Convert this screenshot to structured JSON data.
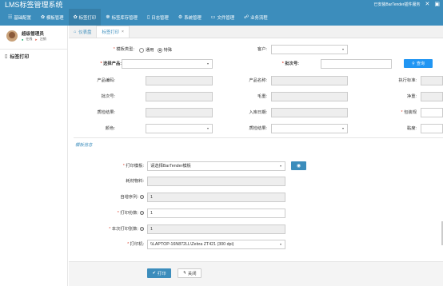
{
  "app": {
    "title": "LMS标签管理系统",
    "install_link": "已安装BarTender插件服务"
  },
  "nav": [
    {
      "icon": "☷",
      "label": "基础配置"
    },
    {
      "icon": "✿",
      "label": "模板管理"
    },
    {
      "icon": "✿",
      "label": "标签打印"
    },
    {
      "icon": "☸",
      "label": "标签库存管理"
    },
    {
      "icon": "▯",
      "label": "日志管理"
    },
    {
      "icon": "⚙",
      "label": "系统管理"
    },
    {
      "icon": "▭",
      "label": "文件管理"
    },
    {
      "icon": "☍",
      "label": "业务流程"
    }
  ],
  "user": {
    "name": "超级管理员",
    "online": "在线",
    "logout": "注销"
  },
  "sidebar": {
    "items": [
      {
        "icon": "▯",
        "label": "标签打印"
      }
    ]
  },
  "tabs": [
    {
      "icon": "⌂",
      "label": "仪表盘"
    },
    {
      "label": "标签打印",
      "close": "×"
    }
  ],
  "form": {
    "template_type_label": "模板类型:",
    "template_type_options": [
      "通用",
      "特殊"
    ],
    "customer_label": "客户:",
    "select_product_label": "选择产品:",
    "batch_label": "批次号:",
    "query_button": "查询",
    "product_code_label": "产品编码:",
    "product_name_label": "产品名称:",
    "exec_standard_label": "执行标准:",
    "batch2_label": "批次号:",
    "gross_weight_label": "毛重:",
    "net_weight_label": "净重:",
    "inspection_result_label": "质检结果:",
    "warehouse_date_label": "入库日期:",
    "package_spec_label": "包装规",
    "color_label": "颜色:",
    "inspection_result2_label": "质检结果:",
    "viscosity_label": "黏度:"
  },
  "template_section": {
    "title": "模板信息",
    "print_template_label": "打印模板:",
    "print_template_value": "请选择BarTender模板",
    "consumable_label": "耗材物料:",
    "auto_serial_label": "自增序列:",
    "auto_serial_value": "1",
    "print_count_label": "打印份数:",
    "print_count_value": "1",
    "current_copies_label": "本次打印张数:",
    "current_copies_value": "1",
    "printer_label": "打印机:",
    "printer_value": "\\\\LAPTOP-16N872LL\\Zebra ZT421 (300 dpi)"
  },
  "footer": {
    "print_button": "打印",
    "close_button": "关闭"
  }
}
